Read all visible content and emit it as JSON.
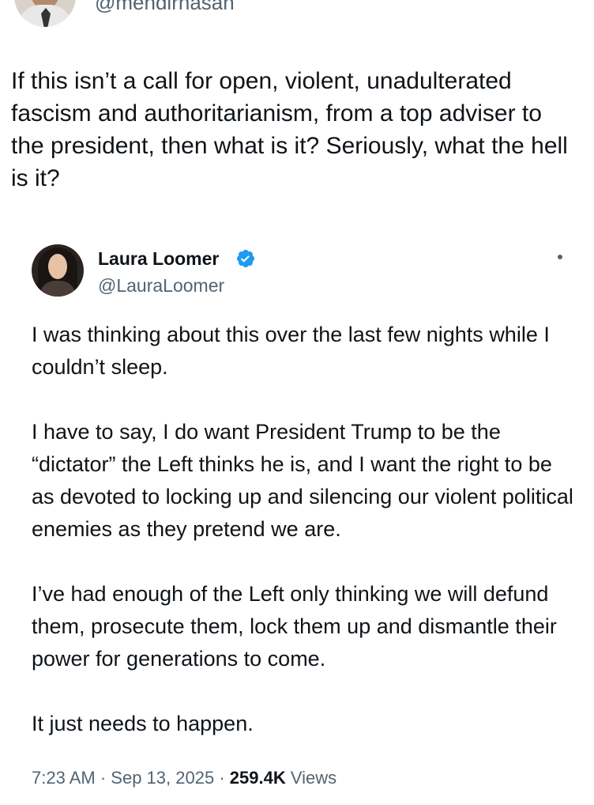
{
  "top": {
    "handle": "@mehdirhasan"
  },
  "tweet": {
    "text": "If this isn’t a call for open, violent, unadulterated fascism and authoritarianism, from a top adviser to the president, then what is it? Seriously, what the hell is it?"
  },
  "quoted": {
    "name": "Laura Loomer",
    "handle": "@LauraLoomer",
    "paragraphs": [
      "I was thinking about this over the last few nights while I couldn’t sleep.",
      "I have to say, I do want President Trump to be the “dictator” the Left thinks he is, and I want the right to be as devoted to locking up and silencing our violent political enemies as they pretend we are.",
      "I’ve had enough of the Left only thinking we will defund them, prosecute them, lock them up and dismantle their power for generations to come.",
      "It just needs to happen."
    ],
    "time": "7:23 AM",
    "date": "Sep 13, 2025",
    "separator": "·",
    "views_count": "259.4K",
    "views_label": "Views"
  },
  "icons": {
    "verified": "verified-badge-icon",
    "more": "more-options-icon"
  },
  "colors": {
    "text": "#0f1419",
    "secondary": "#536471",
    "verified": "#1d9bf0"
  }
}
